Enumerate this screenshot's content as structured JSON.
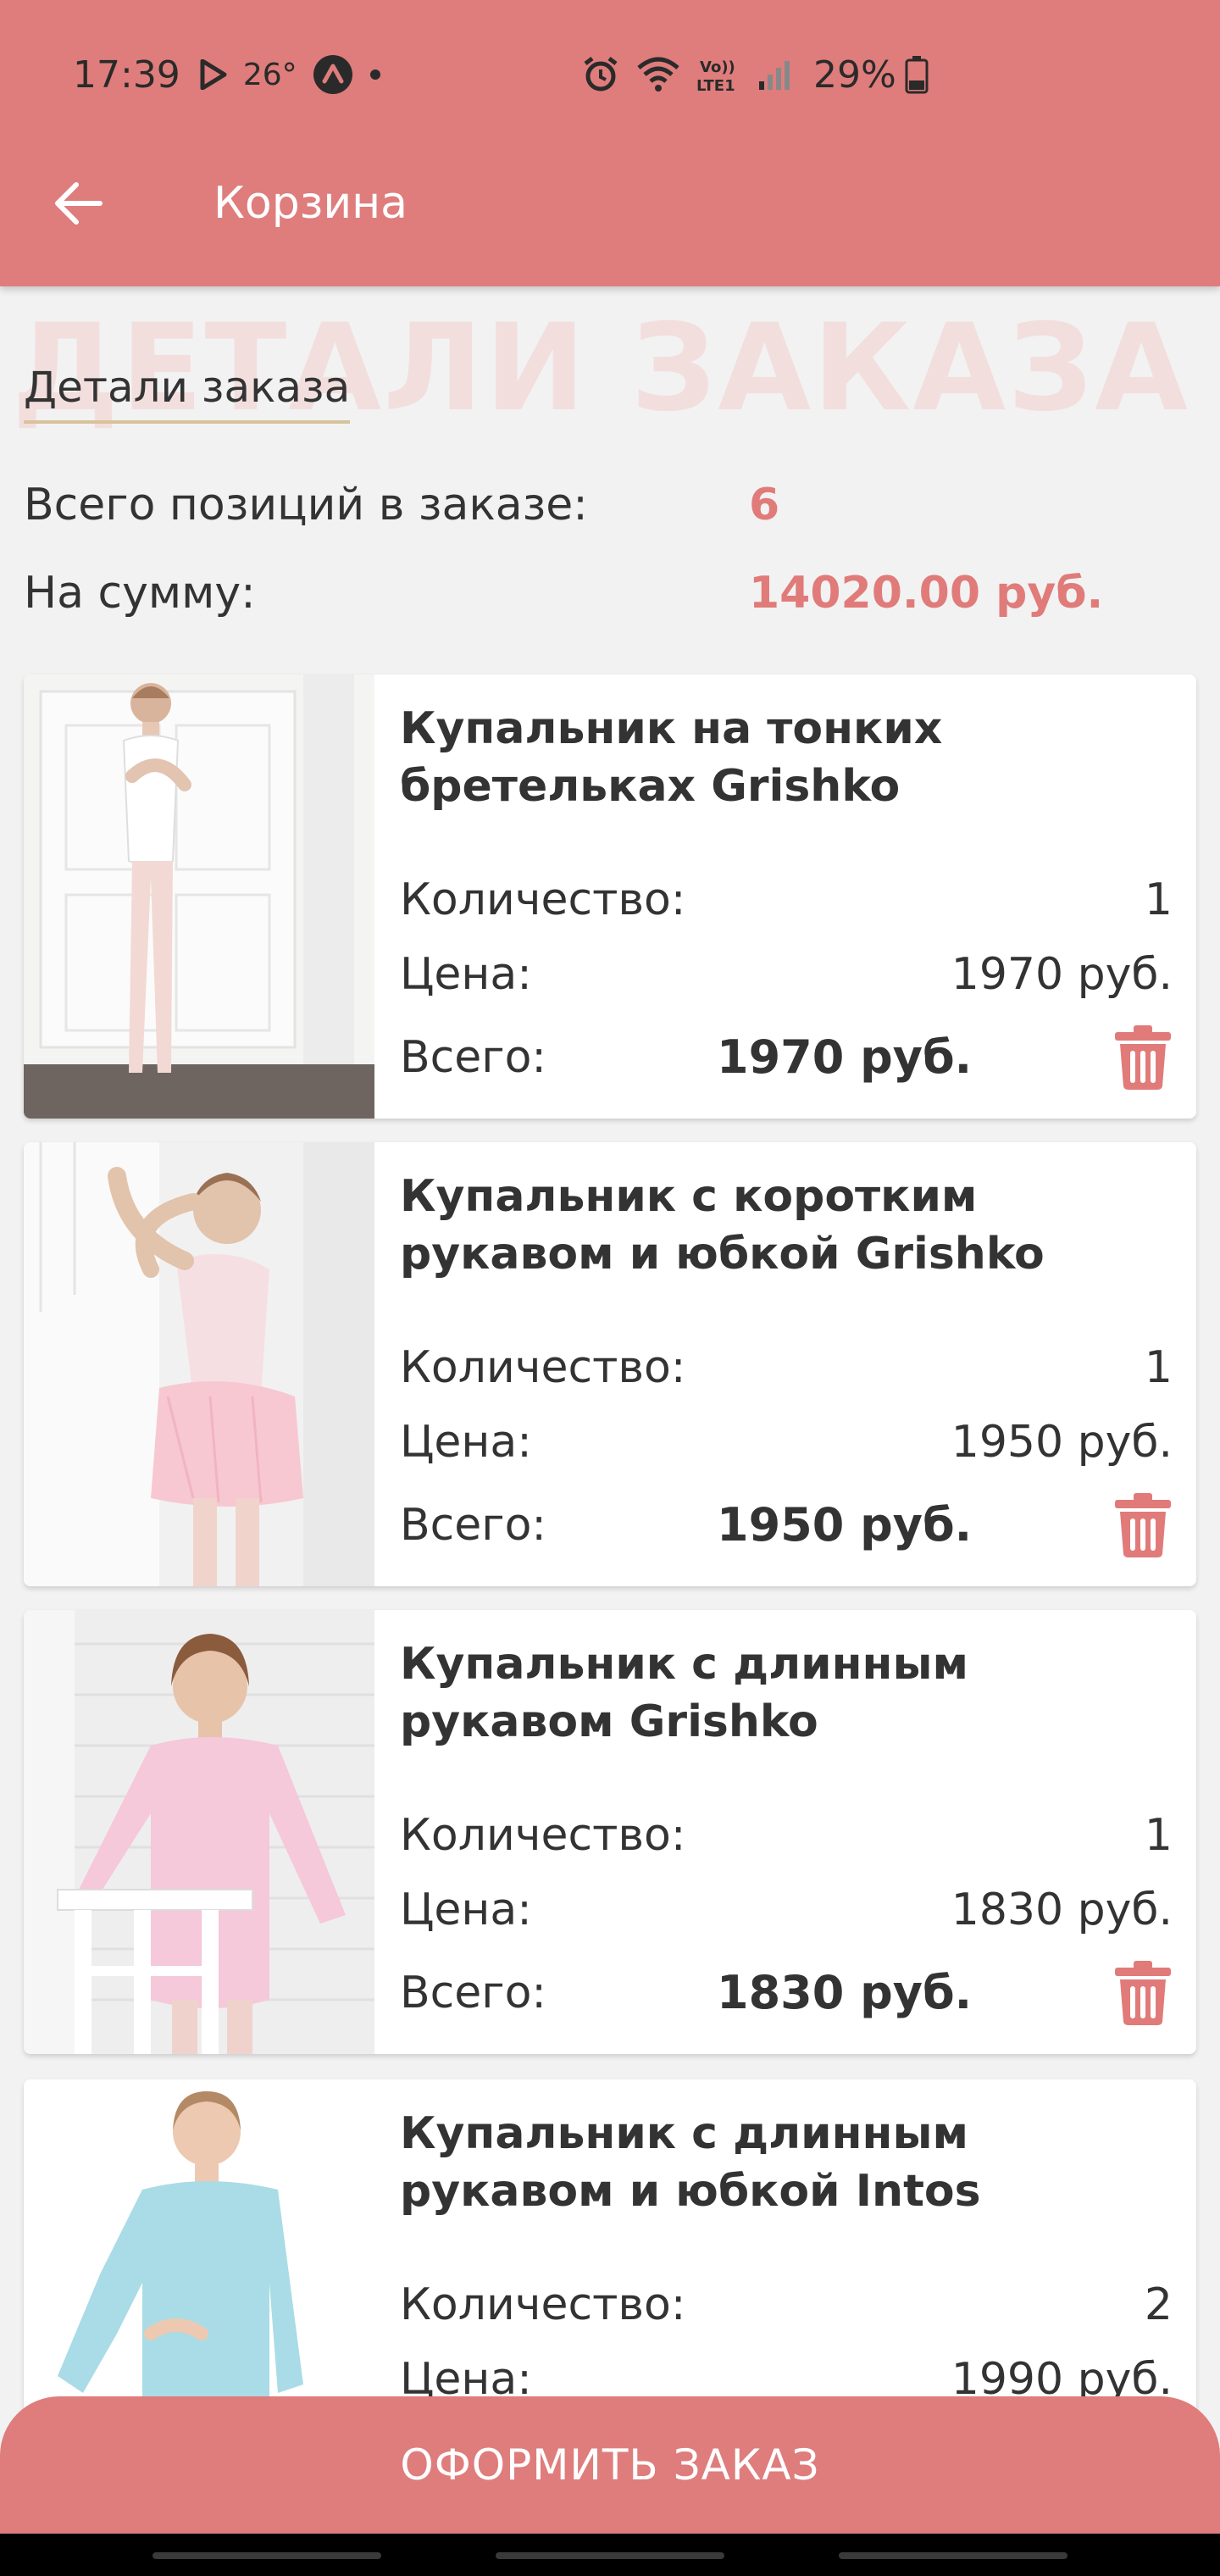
{
  "status_bar": {
    "time": "17:39",
    "temperature": "26°",
    "battery": "29%"
  },
  "app_bar": {
    "title": "Корзина"
  },
  "section": {
    "watermark": "ДЕТАЛИ ЗАКАЗА",
    "title": "Детали заказа"
  },
  "summary": {
    "positions_label": "Всего позиций в заказе:",
    "positions_value": "6",
    "sum_label": "На сумму:",
    "sum_value": "14020.00 руб."
  },
  "items": [
    {
      "title": "Купальник на тонких бретельках Grishko",
      "qty_label": "Количество:",
      "qty": "1",
      "price_label": "Цена:",
      "price": "1970 руб.",
      "total_label": "Всего:",
      "total": "1970 руб."
    },
    {
      "title": "Купальник с коротким рукавом и юбкой Grishko",
      "qty_label": "Количество:",
      "qty": "1",
      "price_label": "Цена:",
      "price": "1950 руб.",
      "total_label": "Всего:",
      "total": "1950 руб."
    },
    {
      "title": "Купальник с длинным рукавом Grishko",
      "qty_label": "Количество:",
      "qty": "1",
      "price_label": "Цена:",
      "price": "1830 руб.",
      "total_label": "Всего:",
      "total": "1830 руб."
    },
    {
      "title": "Купальник с длинным рукавом и юбкой Intos",
      "qty_label": "Количество:",
      "qty": "2",
      "price_label": "Цена:",
      "price": "1990 руб."
    }
  ],
  "checkout": {
    "label": "ОФОРМИТЬ ЗАКАЗ"
  },
  "colors": {
    "accent": "#de7d7c",
    "price_accent": "#e07b7a",
    "background": "#f2f2f2"
  }
}
